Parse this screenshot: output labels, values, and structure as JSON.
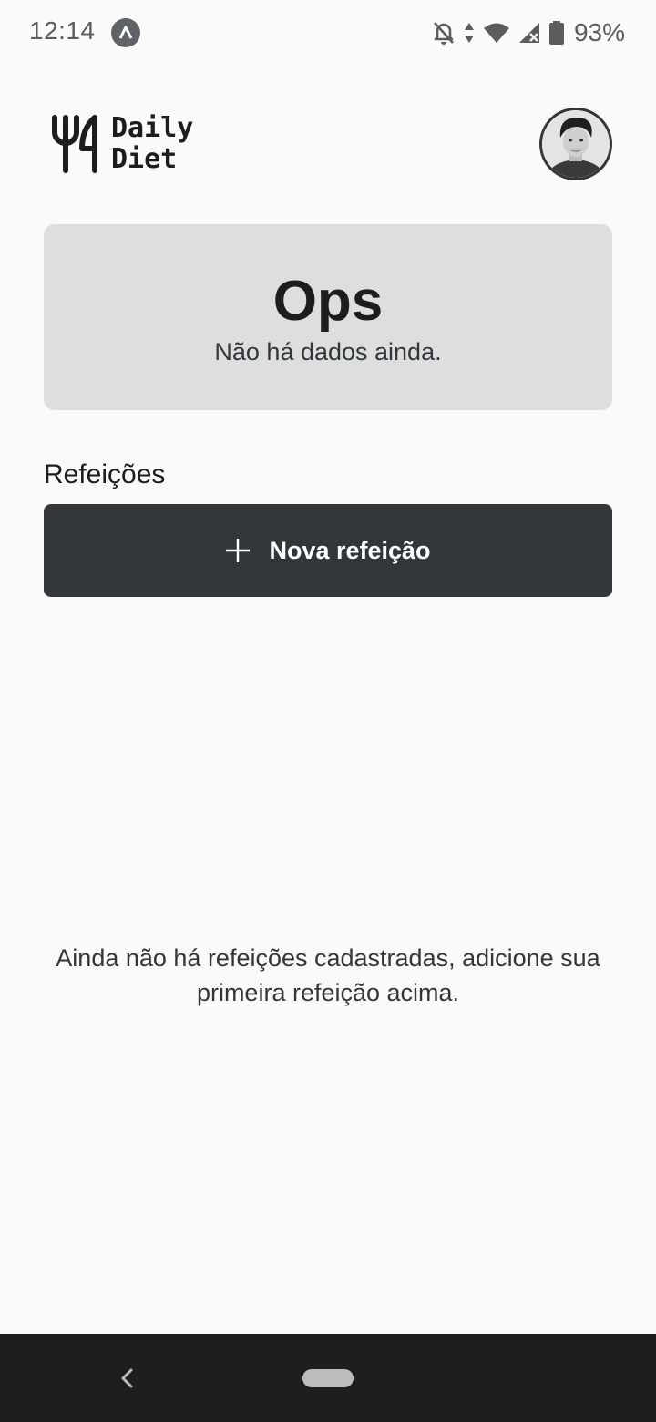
{
  "status_bar": {
    "time": "12:14",
    "battery": "93%",
    "icons": [
      "app-notification-icon",
      "notifications-off-icon",
      "data-arrows-icon",
      "wifi-icon",
      "cell-signal-icon",
      "battery-icon"
    ]
  },
  "header": {
    "logo_line1": "Daily",
    "logo_line2": "Diet",
    "logo_icon": "fork-knife-icon",
    "avatar": "user-avatar"
  },
  "stats": {
    "title": "Ops",
    "subtitle": "Não há dados ainda."
  },
  "meals": {
    "section_label": "Refeições",
    "new_meal_label": "Nova refeição",
    "new_meal_icon": "plus-icon",
    "empty_text": "Ainda não há refeições cadastradas, adicione sua primeira refeição acima."
  },
  "nav": {
    "back_icon": "back-chevron-icon",
    "home_icon": "home-pill-icon"
  },
  "colors": {
    "background": "#FAFAFA",
    "card": "#DDDEDF",
    "button": "#333638",
    "nav_bar": "#1D1E20"
  }
}
